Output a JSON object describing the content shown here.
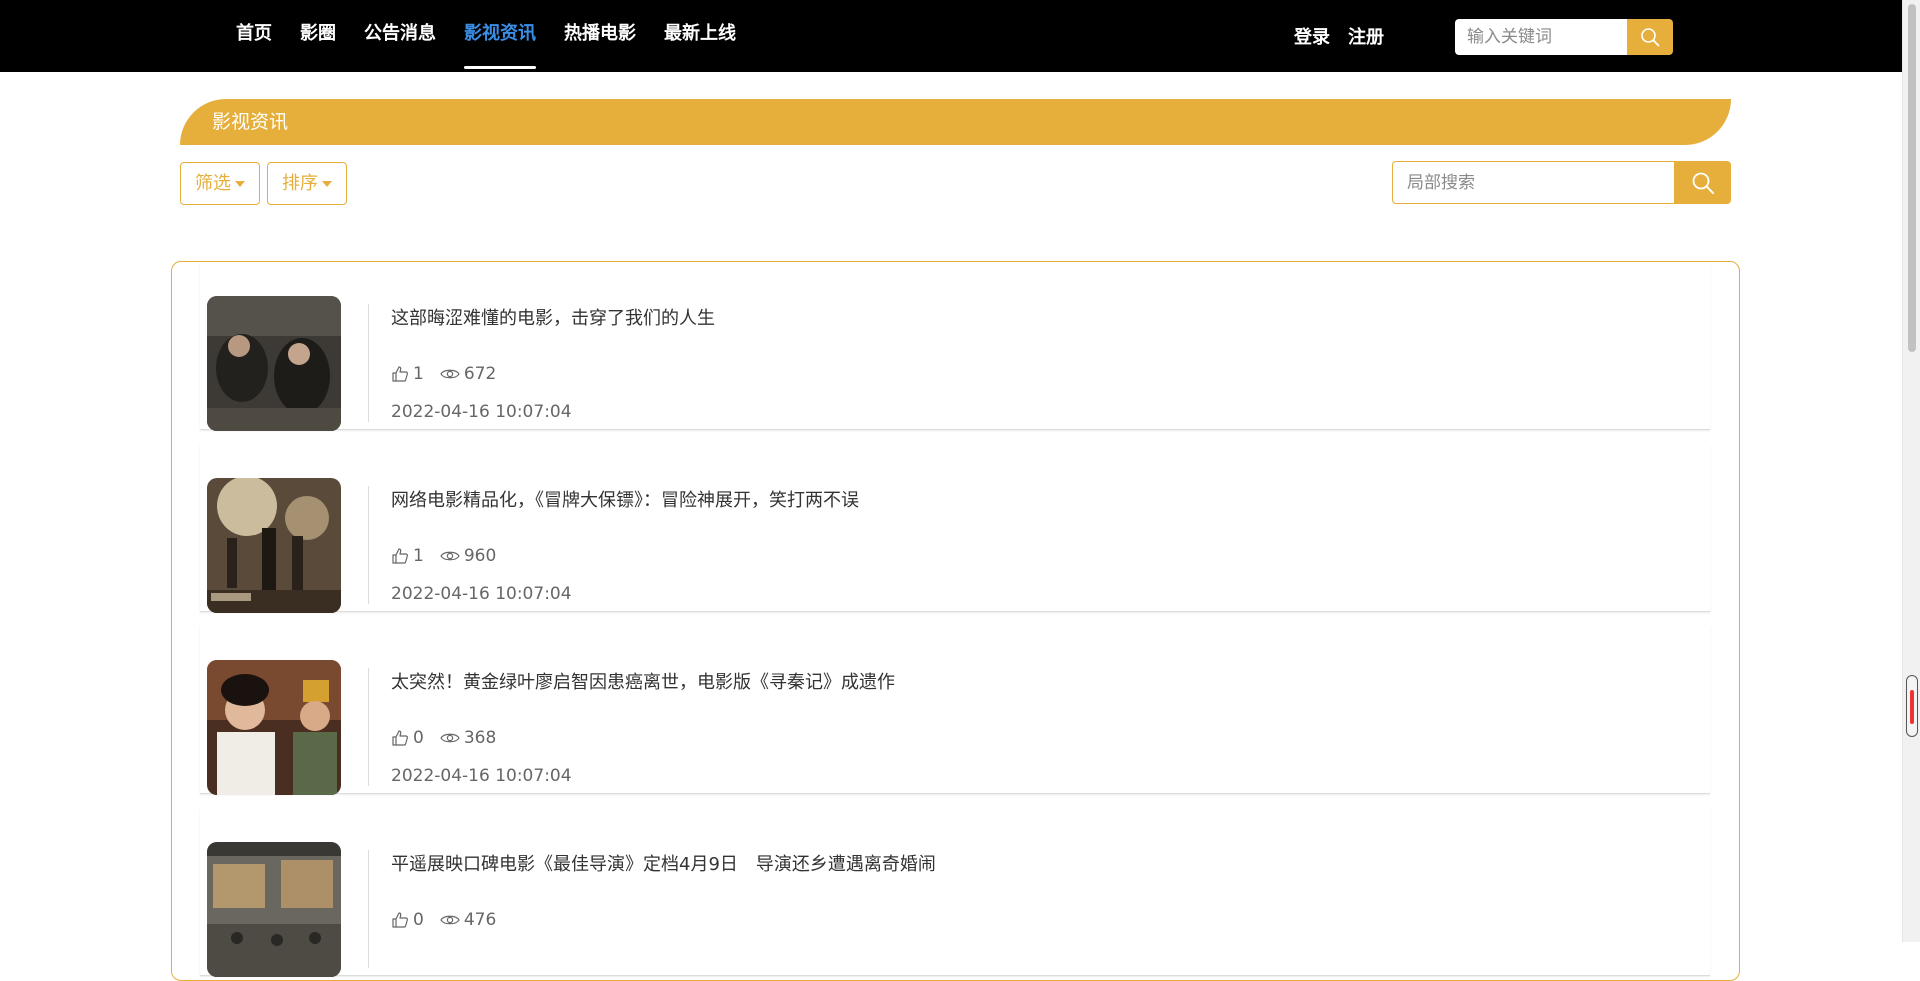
{
  "nav": {
    "items": [
      {
        "label": "首页",
        "active": false
      },
      {
        "label": "影圈",
        "active": false
      },
      {
        "label": "公告消息",
        "active": false
      },
      {
        "label": "影视资讯",
        "active": true
      },
      {
        "label": "热播电影",
        "active": false
      },
      {
        "label": "最新上线",
        "active": false
      }
    ],
    "login_label": "登录",
    "register_label": "注册",
    "search_placeholder": "输入关键词"
  },
  "section": {
    "title": "影视资讯"
  },
  "filters": {
    "filter_label": "筛选",
    "sort_label": "排序",
    "local_search_placeholder": "局部搜索"
  },
  "articles": [
    {
      "title": "这部晦涩难懂的电影，击穿了我们的人生",
      "likes": "1",
      "views": "672",
      "date": "2022-04-16 10:07:04"
    },
    {
      "title": "网络电影精品化，《冒牌大保镖》：冒险神展开，笑打两不误",
      "likes": "1",
      "views": "960",
      "date": "2022-04-16 10:07:04"
    },
    {
      "title": "太突然！黄金绿叶廖启智因患癌离世，电影版《寻秦记》成遗作",
      "likes": "0",
      "views": "368",
      "date": "2022-04-16 10:07:04"
    },
    {
      "title": "平遥展映口碑电影《最佳导演》定档4月9日　导演还乡遭遇离奇婚闹",
      "likes": "0",
      "views": "476",
      "date": ""
    }
  ],
  "colors": {
    "accent": "#e6af3b",
    "nav_bg": "#000000",
    "nav_active": "#3a8ee6"
  },
  "icons": {
    "search": "search-icon",
    "like": "thumbs-up-icon",
    "views": "eye-icon",
    "caret": "caret-down-icon"
  }
}
